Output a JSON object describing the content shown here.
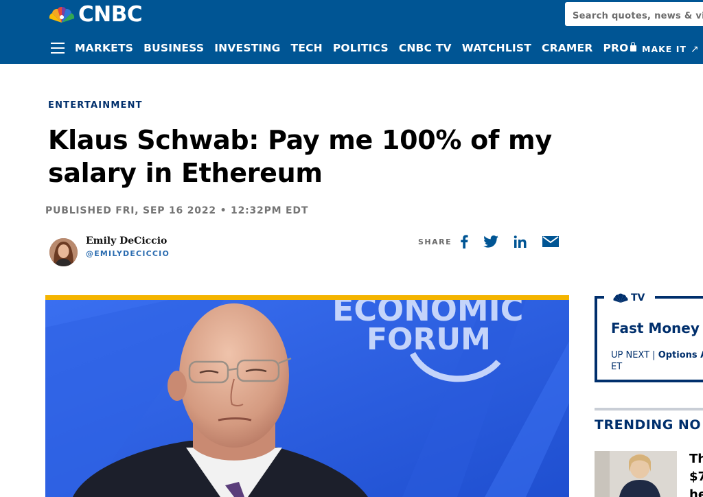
{
  "header": {
    "brand": "CNBC",
    "search_placeholder": "Search quotes, news & videos",
    "nav_items": [
      "MARKETS",
      "BUSINESS",
      "INVESTING",
      "TECH",
      "POLITICS",
      "CNBC TV",
      "WATCHLIST",
      "CRAMER",
      "PRO"
    ],
    "make_it": "MAKE IT"
  },
  "article": {
    "section": "ENTERTAINMENT",
    "headline": "Klaus Schwab: Pay me 100% of my salary in Ethereum",
    "published": "PUBLISHED FRI, SEP 16 2022 • 12:32PM EDT",
    "author_name": "Emily DeCiccio",
    "author_handle": "@EMILYDECICCIO",
    "share_label": "SHARE",
    "hero_sign_line1": "ECONOMIC",
    "hero_sign_line2": "FORUM"
  },
  "sidebar": {
    "tv_label": "TV",
    "show_title": "Fast Money",
    "up_next_label": "UP NEXT |",
    "up_next_show": "Options A",
    "up_next_tz": "ET",
    "trending_label": "TRENDING NO",
    "trending_item_line1": "Th",
    "trending_item_line2": "$7",
    "trending_item_line3": "he"
  },
  "colors": {
    "header_bg": "#005594",
    "brand_navy": "#002f6c",
    "hero_accent": "#f4b400",
    "hero_bg": "#2b5fe0"
  },
  "icons": [
    "menu-icon",
    "lock-icon",
    "external-arrow-icon",
    "facebook-icon",
    "twitter-icon",
    "linkedin-icon",
    "email-icon",
    "peacock-icon"
  ]
}
